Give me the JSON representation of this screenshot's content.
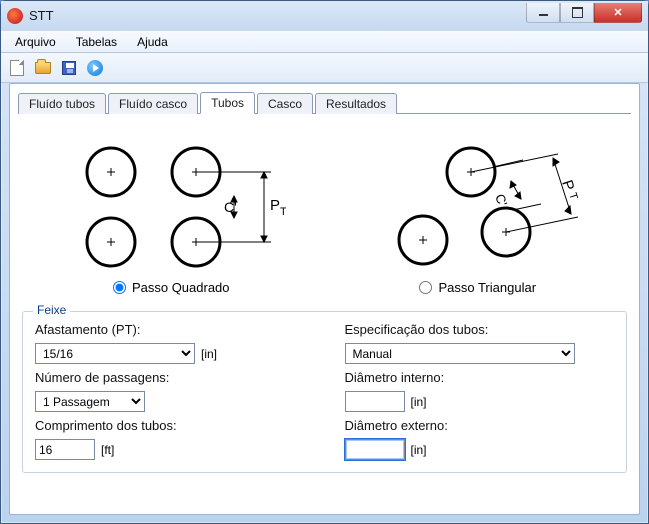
{
  "window": {
    "title": "STT"
  },
  "menu": {
    "arquivo": "Arquivo",
    "tabelas": "Tabelas",
    "ajuda": "Ajuda"
  },
  "tabs": {
    "fluido_tubos": "Fluído tubos",
    "fluido_casco": "Fluído casco",
    "tubos": "Tubos",
    "casco": "Casco",
    "resultados": "Resultados"
  },
  "diagram": {
    "c_label": "C'",
    "pt_label": "P",
    "pt_sub": "T",
    "radio_quadrado": "Passo Quadrado",
    "radio_triangular": "Passo Triangular"
  },
  "feixe": {
    "legend": "Feixe",
    "afastamento_label": "Afastamento (PT):",
    "afastamento_value": "15/16",
    "afastamento_unit": "[in]",
    "passagens_label": "Número de passagens:",
    "passagens_value": "1 Passagem",
    "comprimento_label": "Comprimento dos tubos:",
    "comprimento_value": "16",
    "comprimento_unit": "[ft]",
    "espec_label": "Especificação dos tubos:",
    "espec_value": "Manual",
    "diam_int_label": "Diâmetro interno:",
    "diam_int_value": "",
    "diam_int_unit": "[in]",
    "diam_ext_label": "Diâmetro externo:",
    "diam_ext_value": "",
    "diam_ext_unit": "[in]"
  }
}
